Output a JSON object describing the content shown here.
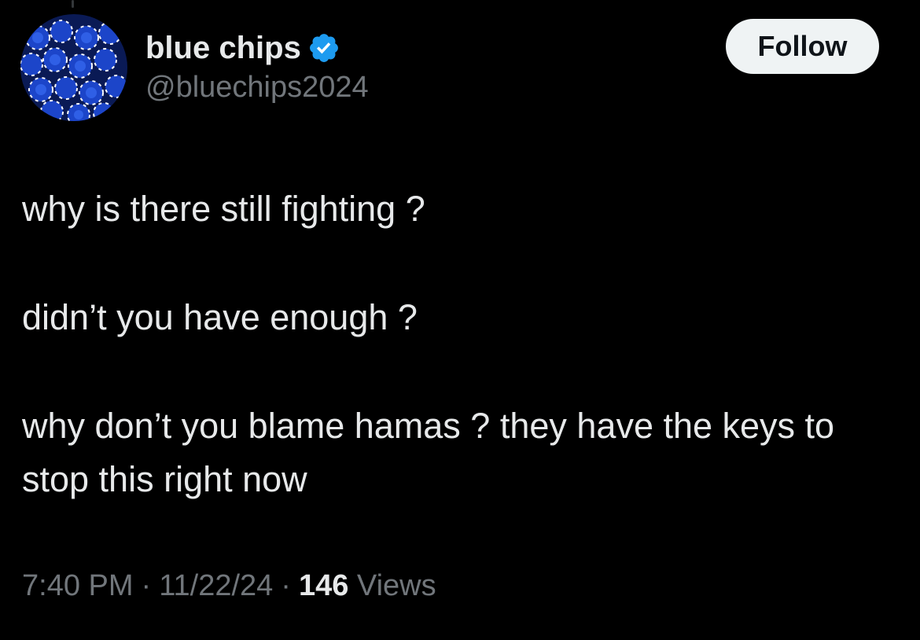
{
  "tweet": {
    "author": {
      "display_name": "blue chips",
      "handle": "@bluechips2024",
      "verified": true,
      "avatar_icon": "blue-poker-chips-avatar"
    },
    "follow_label": "Follow",
    "paragraphs": [
      "why is there still fighting ?",
      "didn’t you have enough ?",
      "why don’t you blame hamas ? they have the keys to stop this right now"
    ],
    "time": "7:40 PM",
    "date": "11/22/24",
    "separator": "·",
    "views_count": "146",
    "views_label": "Views"
  },
  "colors": {
    "background": "#000000",
    "primary_text": "#e7e9ea",
    "secondary_text": "#71767b",
    "verified_badge": "#1d9bf0",
    "follow_button_bg": "#eff3f4",
    "follow_button_text": "#0f1419"
  }
}
